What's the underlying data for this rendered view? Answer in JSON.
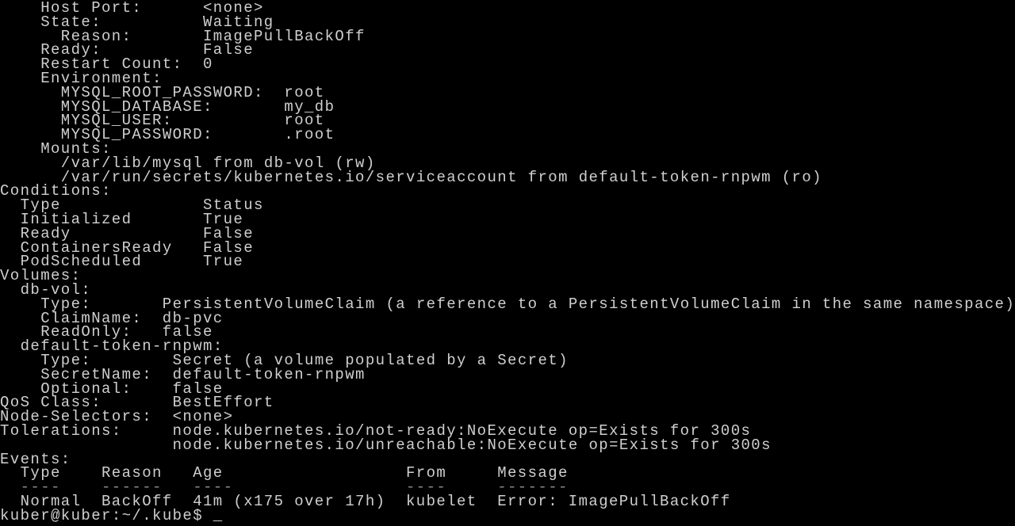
{
  "terminal": {
    "container": {
      "host_port": {
        "label": "Host Port:",
        "value": "<none>"
      },
      "state": {
        "label": "State:",
        "value": "Waiting"
      },
      "reason": {
        "label": "Reason:",
        "value": "ImagePullBackOff"
      },
      "ready": {
        "label": "Ready:",
        "value": "False"
      },
      "restart_count": {
        "label": "Restart Count:",
        "value": "0"
      },
      "environment": {
        "label": "Environment:",
        "vars": [
          {
            "name": "MYSQL_ROOT_PASSWORD:",
            "value": "root"
          },
          {
            "name": "MYSQL_DATABASE:",
            "value": "my_db"
          },
          {
            "name": "MYSQL_USER:",
            "value": "root"
          },
          {
            "name": "MYSQL_PASSWORD:",
            "value": ".root"
          }
        ]
      },
      "mounts": {
        "label": "Mounts:",
        "items": [
          "/var/lib/mysql from db-vol (rw)",
          "/var/run/secrets/kubernetes.io/serviceaccount from default-token-rnpwm (ro)"
        ]
      }
    },
    "conditions": {
      "label": "Conditions:",
      "headers": [
        "Type",
        "Status"
      ],
      "rows": [
        [
          "Initialized",
          "True"
        ],
        [
          "Ready",
          "False"
        ],
        [
          "ContainersReady",
          "False"
        ],
        [
          "PodScheduled",
          "True"
        ]
      ]
    },
    "volumes": {
      "label": "Volumes:",
      "items": [
        {
          "name": "db-vol:",
          "fields": [
            {
              "label": "Type:",
              "value": "PersistentVolumeClaim (a reference to a PersistentVolumeClaim in the same namespace)"
            },
            {
              "label": "ClaimName:",
              "value": "db-pvc"
            },
            {
              "label": "ReadOnly:",
              "value": "false"
            }
          ]
        },
        {
          "name": "default-token-rnpwm:",
          "fields": [
            {
              "label": "Type:",
              "value": "Secret (a volume populated by a Secret)"
            },
            {
              "label": "SecretName:",
              "value": "default-token-rnpwm"
            },
            {
              "label": "Optional:",
              "value": "false"
            }
          ]
        }
      ]
    },
    "qos_class": {
      "label": "QoS Class:",
      "value": "BestEffort"
    },
    "node_selectors": {
      "label": "Node-Selectors:",
      "value": "<none>"
    },
    "tolerations": {
      "label": "Tolerations:",
      "values": [
        "node.kubernetes.io/not-ready:NoExecute op=Exists for 300s",
        "node.kubernetes.io/unreachable:NoExecute op=Exists for 300s"
      ]
    },
    "events": {
      "label": "Events:",
      "headers": [
        "Type",
        "Reason",
        "Age",
        "From",
        "Message"
      ],
      "underlines": [
        "----",
        "------",
        "----",
        "----",
        "-------"
      ],
      "rows": [
        [
          "Normal",
          "BackOff",
          "41m (x175 over 17h)",
          "kubelet",
          "Error: ImagePullBackOff"
        ]
      ]
    },
    "prompt": {
      "text": "kuber@kuber:~/.kube$",
      "cursor": "_"
    }
  }
}
